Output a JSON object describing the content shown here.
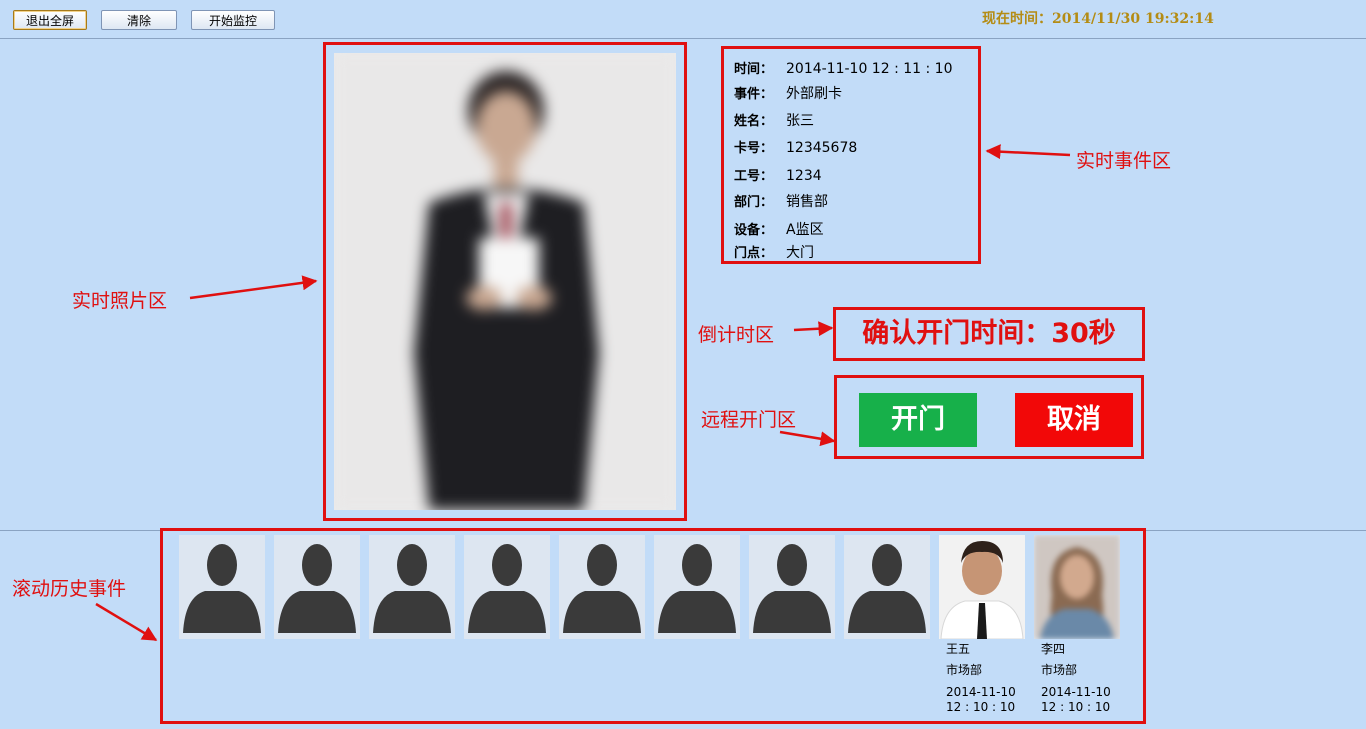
{
  "toolbar": {
    "exit_fullscreen": "退出全屏",
    "clear": "清除",
    "start_monitor": "开始监控",
    "clock": "现在时间：2014/11/30 19:32:14"
  },
  "event": {
    "rows": [
      {
        "label": "时间：",
        "value": "2014-11-10 12 : 11 : 10"
      },
      {
        "label": "事件：",
        "value": "外部刷卡"
      },
      {
        "label": "姓名：",
        "value": "张三"
      },
      {
        "label": "卡号：",
        "value": "12345678"
      },
      {
        "label": "工号：",
        "value": "1234"
      },
      {
        "label": "部门：",
        "value": "销售部"
      },
      {
        "label": "设备：",
        "value": "A监区"
      },
      {
        "label": "门点：",
        "value": "大门"
      }
    ]
  },
  "countdown": {
    "text": "确认开门时间：30秒"
  },
  "remote": {
    "open": "开门",
    "cancel": "取消"
  },
  "annotations": {
    "photo": "实时照片区",
    "event": "实时事件区",
    "countdown": "倒计时区",
    "remote": "远程开门区",
    "history": "滚动历史事件"
  },
  "history": {
    "items": [
      {
        "type": "placeholder",
        "icon": "user-silhouette-icon"
      },
      {
        "type": "placeholder",
        "icon": "user-silhouette-icon"
      },
      {
        "type": "placeholder",
        "icon": "user-silhouette-icon"
      },
      {
        "type": "placeholder",
        "icon": "user-silhouette-icon"
      },
      {
        "type": "placeholder",
        "icon": "user-silhouette-icon"
      },
      {
        "type": "placeholder",
        "icon": "user-silhouette-icon"
      },
      {
        "type": "placeholder",
        "icon": "user-silhouette-icon"
      },
      {
        "type": "placeholder",
        "icon": "user-silhouette-icon"
      },
      {
        "type": "photo",
        "name": "王五",
        "dept": "市场部",
        "date": "2014-11-10",
        "time": "12 : 10 : 10"
      },
      {
        "type": "photo",
        "name": "李四",
        "dept": "市场部",
        "date": "2014-11-10",
        "time": "12 : 10 : 10"
      }
    ]
  },
  "colors": {
    "background": "#c2dcf8",
    "annotation": "#e01010",
    "open": "#17b04a",
    "cancel": "#f20808",
    "clock": "#b48c14"
  }
}
